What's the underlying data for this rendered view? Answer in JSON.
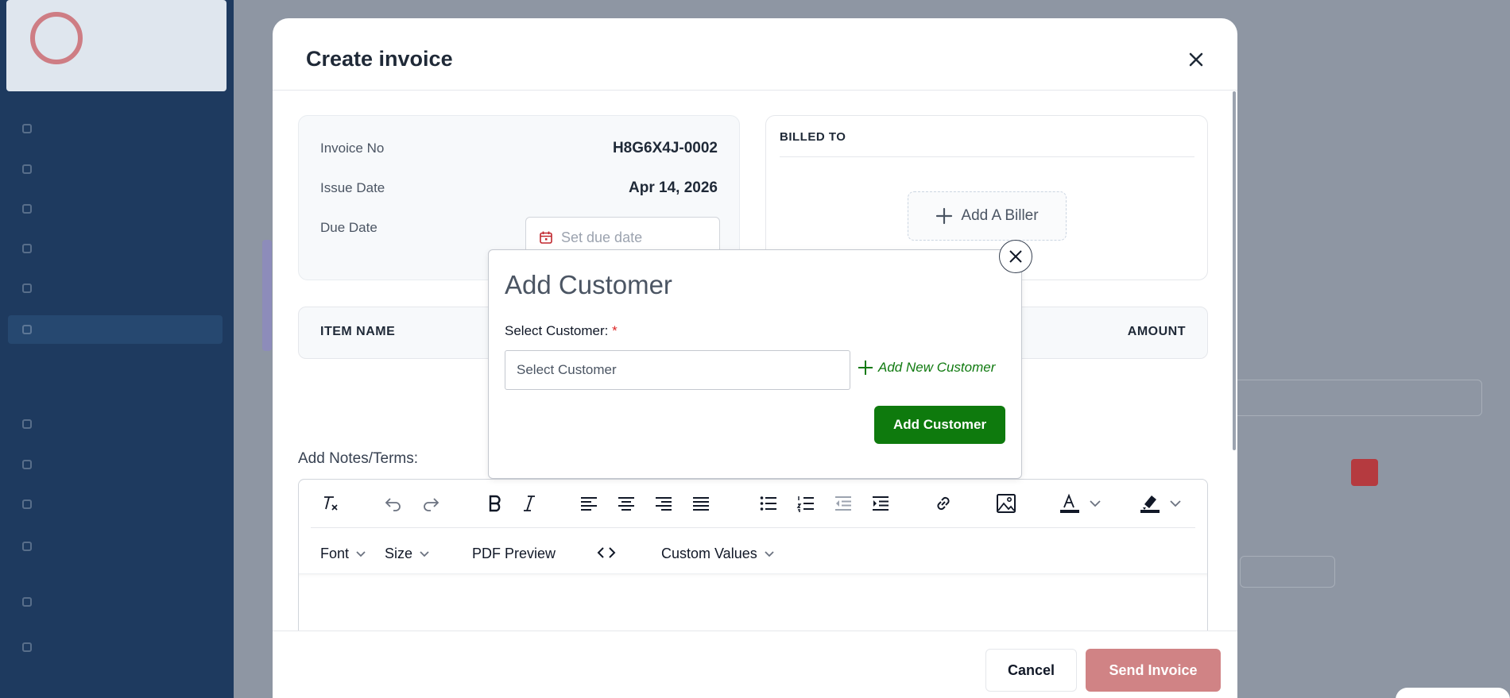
{
  "invoice_modal": {
    "title": "Create invoice",
    "invoice_no_label": "Invoice No",
    "invoice_no_value": "H8G6X4J-0002",
    "issue_date_label": "Issue Date",
    "issue_date_value": "Apr 14, 2026",
    "due_date_label": "Due Date",
    "due_date_placeholder": "Set due date",
    "billed_to_title": "BILLED TO",
    "add_biller_label": "Add A Biller",
    "items_header": {
      "item_name": "ITEM NAME",
      "amount": "AMOUNT"
    },
    "notes_label": "Add Notes/Terms:",
    "editor_toolbar": {
      "font_label": "Font",
      "size_label": "Size",
      "pdf_preview_label": "PDF Preview",
      "custom_values_label": "Custom Values"
    },
    "cancel_label": "Cancel",
    "send_label": "Send Invoice"
  },
  "add_customer_popup": {
    "title": "Add Customer",
    "select_label": "Select Customer:",
    "required_mark": "*",
    "select_placeholder": "Select Customer",
    "add_new_label": "Add New Customer",
    "submit_label": "Add Customer"
  },
  "colors": {
    "brand_red": "#c0262d",
    "send_button": "#d08385",
    "add_customer_green": "#0e7a0d",
    "add_new_link_green": "#107a10",
    "sidebar": "#1e3a5f"
  },
  "icons": [
    "close-icon",
    "calendar-icon",
    "plus-icon",
    "clear-format-icon",
    "undo-icon",
    "redo-icon",
    "bold-icon",
    "italic-icon",
    "align-left-icon",
    "align-center-icon",
    "align-right-icon",
    "align-justify-icon",
    "bullet-list-icon",
    "numbered-list-icon",
    "outdent-icon",
    "indent-icon",
    "link-icon",
    "image-icon",
    "text-color-icon",
    "highlight-icon",
    "code-icon",
    "chevron-down-icon"
  ]
}
